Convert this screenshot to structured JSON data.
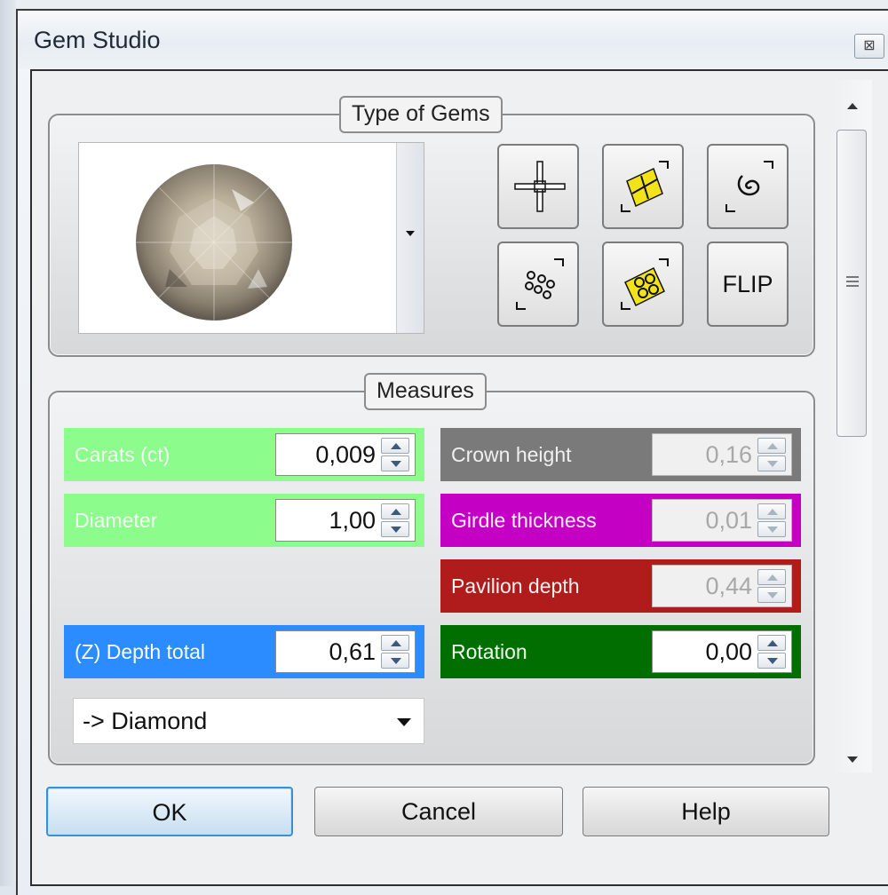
{
  "window": {
    "title": "Gem Studio"
  },
  "gem_type": {
    "group_label": "Type of Gems",
    "tools": [
      {
        "name": "center-cross-icon"
      },
      {
        "name": "transform-gem-icon"
      },
      {
        "name": "spiral-icon"
      },
      {
        "name": "scatter-gems-icon"
      },
      {
        "name": "multi-gem-transform-icon"
      },
      {
        "name": "flip",
        "label": "FLIP"
      }
    ]
  },
  "measures": {
    "group_label": "Measures",
    "carats": {
      "label": "Carats (ct)",
      "value": "0,009",
      "color": "#8cfc8c"
    },
    "diameter": {
      "label": "Diameter",
      "value": "1,00",
      "color": "#8cfc8c"
    },
    "depth_total": {
      "label": "(Z) Depth total",
      "value": "0,61",
      "color": "#2a8cff"
    },
    "crown_height": {
      "label": "Crown height",
      "value": "0,16",
      "color": "#7a7a7a"
    },
    "girdle_thickness": {
      "label": "Girdle thickness",
      "value": "0,01",
      "color": "#c400c4"
    },
    "pavilion_depth": {
      "label": "Pavilion depth",
      "value": "0,44",
      "color": "#b01c1c"
    },
    "rotation": {
      "label": "Rotation",
      "value": "0,00",
      "color": "#006e00"
    },
    "shape_select": "-> Diamond"
  },
  "buttons": {
    "ok": "OK",
    "cancel": "Cancel",
    "help": "Help"
  }
}
